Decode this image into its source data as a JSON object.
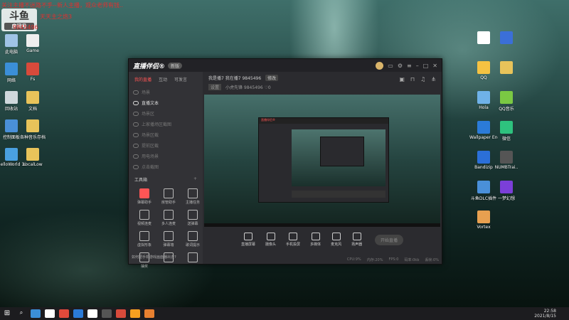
{
  "overlay": {
    "logo_big": "斗鱼",
    "logo_small": "房间号",
    "lines": [
      "关注主播不迷路不手--",
      "新人主播，观众老师有钱..",
      "天天主之炮3",
      "9845496"
    ]
  },
  "desktop_left": [
    {
      "label": "此电脑",
      "color": "#9fc3e6"
    },
    {
      "label": "Game",
      "color": "#eeeeee"
    },
    {
      "label": "网络",
      "color": "#3b8fd8"
    },
    {
      "label": "Fs",
      "color": "#d84a3b"
    },
    {
      "label": "回收站",
      "color": "#cfd8dc"
    },
    {
      "label": "文档",
      "color": "#e8c35a"
    },
    {
      "label": "控制面板",
      "color": "#4a90d9"
    },
    {
      "label": "各种音乐存档",
      "color": "#e8c35a"
    },
    {
      "label": "HelloWorld 10.4",
      "color": "#4aa0e0"
    },
    {
      "label": "LocalLow",
      "color": "#e8c35a"
    }
  ],
  "desktop_right": [
    {
      "label": "",
      "color": "#ffffff"
    },
    {
      "label": "",
      "color": "#3b6fd8"
    },
    {
      "label": "QQ",
      "color": "#f5c242"
    },
    {
      "label": "",
      "color": "#e8c35a"
    },
    {
      "label": "Hola",
      "color": "#6fb2e8"
    },
    {
      "label": "QQ音乐",
      "color": "#7ac943"
    },
    {
      "label": "Wallpaper Engine",
      "color": "#2b7bd8"
    },
    {
      "label": "微信",
      "color": "#2ec27e"
    },
    {
      "label": "Bandizip",
      "color": "#2b6fd8"
    },
    {
      "label": "NUMBTrai..",
      "color": "#555555"
    },
    {
      "label": "斗鱼DLC插件",
      "color": "#4a90d9"
    },
    {
      "label": "一梦幻想",
      "color": "#7b3fd8"
    },
    {
      "label": "Vortex",
      "color": "#e8a050"
    }
  ],
  "app": {
    "brand": "直播伴侣®",
    "badge": "新版",
    "side_tabs": [
      "我的直播",
      "互动",
      "可发言"
    ],
    "scenes": [
      "场景",
      "直播文本",
      "场景区",
      "上家播场区截图",
      "场景区截",
      "提前区截",
      "用电场景",
      "点击截图"
    ],
    "active_scene": 1,
    "tools_title": "工具箱",
    "tools_more": "+",
    "tools": [
      {
        "label": "弹幕助手",
        "hot": true
      },
      {
        "label": "房管助手",
        "hot": false
      },
      {
        "label": "主播任务",
        "hot": false
      },
      {
        "label": "视频连麦",
        "hot": false
      },
      {
        "label": "多人连麦",
        "hot": false
      },
      {
        "label": "送弹幕",
        "hot": false
      },
      {
        "label": "虚拟形象",
        "hot": false
      },
      {
        "label": "弹幕墙",
        "hot": false
      },
      {
        "label": "歌词提示",
        "hot": false
      },
      {
        "label": "抽奖",
        "hot": false
      },
      {
        "label": "",
        "hot": false
      },
      {
        "label": "",
        "hot": false
      }
    ],
    "tip": "如何把手机游戏画面播出去?",
    "room_title": "我是播7 我在播7 9845496",
    "room_edit": "修改",
    "room_tag": "设置",
    "room_line2": "小虎先锋 9845496 ♡0",
    "controls": [
      "直播屏幕",
      "摄像头",
      "手机投屏",
      "多媒体",
      "麦克风",
      "扬声器"
    ],
    "go_live": "开始直播",
    "status": [
      "CPU:9%",
      "内存:20%",
      "FPS:0",
      "码率:0kb",
      "丢帧:0%"
    ]
  },
  "taskbar": {
    "time": "22:58",
    "date": "2021/8/15",
    "apps": [
      "#3b8fd8",
      "#ffffff",
      "#e04a3b",
      "#2b7bd8",
      "#ffffff",
      "#555555",
      "#d84a3b",
      "#f5a020",
      "#e88030"
    ]
  }
}
